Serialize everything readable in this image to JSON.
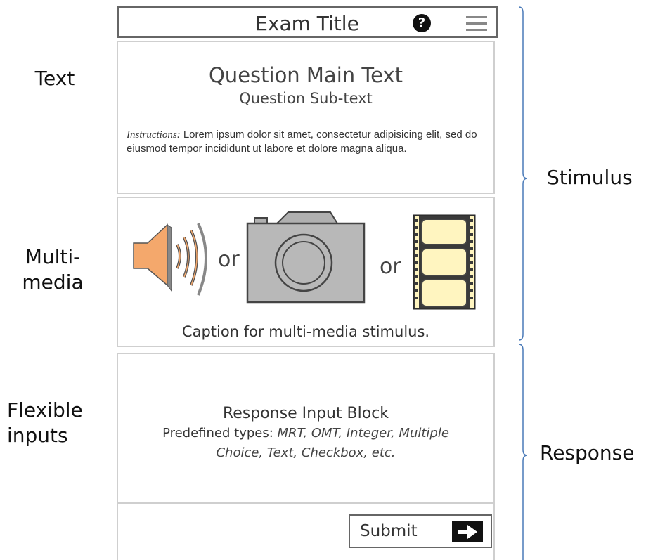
{
  "side_labels": {
    "text": "Text",
    "multimedia_line1": "Multi-",
    "multimedia_line2": "media",
    "flexible_line1": "Flexible",
    "flexible_line2": "inputs"
  },
  "right_labels": {
    "stimulus": "Stimulus",
    "response": "Response"
  },
  "header": {
    "title": "Exam Title",
    "help_icon": "?",
    "help_icon_name": "help-circle-icon",
    "menu_icon_name": "hamburger-menu-icon"
  },
  "question": {
    "main_text": "Question Main Text",
    "sub_text": "Question Sub-text",
    "instructions_label": "Instructions:",
    "instructions_body": " Lorem ipsum dolor sit amet, consectetur adipisicing elit, sed do eiusmod tempor incididunt ut labore et dolore magna aliqua."
  },
  "multimedia": {
    "icons": [
      "speaker-icon",
      "camera-icon",
      "film-strip-icon"
    ],
    "or_1": "or",
    "or_2": "or",
    "caption": "Caption for multi-media stimulus."
  },
  "response": {
    "title": "Response Input Block",
    "types_label": "Predefined types: ",
    "types_italic_1": "MRT, OMT, Integer, Multiple",
    "types_italic_2": "Choice, Text, Checkbox, etc."
  },
  "submit": {
    "label": "Submit",
    "icon_name": "arrow-right-icon"
  },
  "colors": {
    "bracket": "#4a7ab8",
    "speaker_fill": "#f4a86c",
    "film_frame": "#fff5c0",
    "panel_border": "#cfcfcf"
  }
}
